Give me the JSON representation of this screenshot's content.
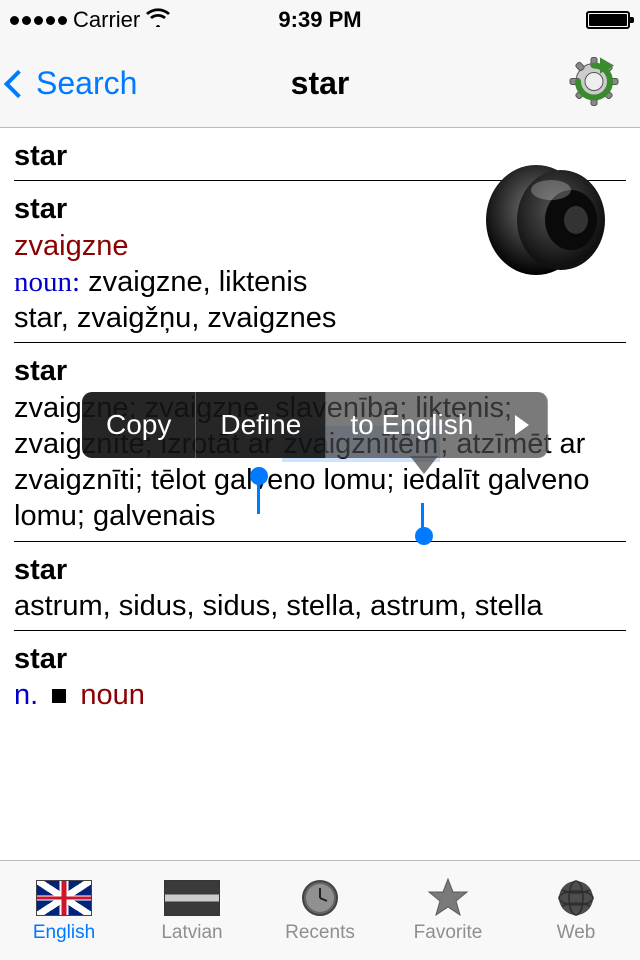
{
  "status": {
    "carrier": "Carrier",
    "time": "9:39 PM"
  },
  "nav": {
    "back": "Search",
    "title": "star"
  },
  "entry1": {
    "hw": "star"
  },
  "entry2": {
    "hw": "star",
    "translation": "zvaigzne",
    "pos_label": "noun:",
    "pos_words": " zvaigzne, liktenis",
    "line2": "star, zvaigžņu, zvaigznes"
  },
  "entry3": {
    "hw": "star",
    "body_pre": "zvaigzne; zvaigzne, slavenība; liktenis; zvaigznīte; izrotāt ar ",
    "sel": "zvaigznītēm",
    "body_post": "; atzīmēt ar zvaigznīti; tēlot galveno lomu; iedalīt galveno lomu; galvenais"
  },
  "entry4": {
    "hw": "star",
    "body": "astrum, sidus, sidus, stella, astrum, stella"
  },
  "entry5": {
    "hw": "star",
    "pos_abbrev": "n.",
    "pos_word": "noun"
  },
  "context_menu": {
    "copy": "Copy",
    "define": "Define",
    "to_english": "to English"
  },
  "tabs": {
    "english": "English",
    "latvian": "Latvian",
    "recents": "Recents",
    "favorite": "Favorite",
    "web": "Web"
  }
}
